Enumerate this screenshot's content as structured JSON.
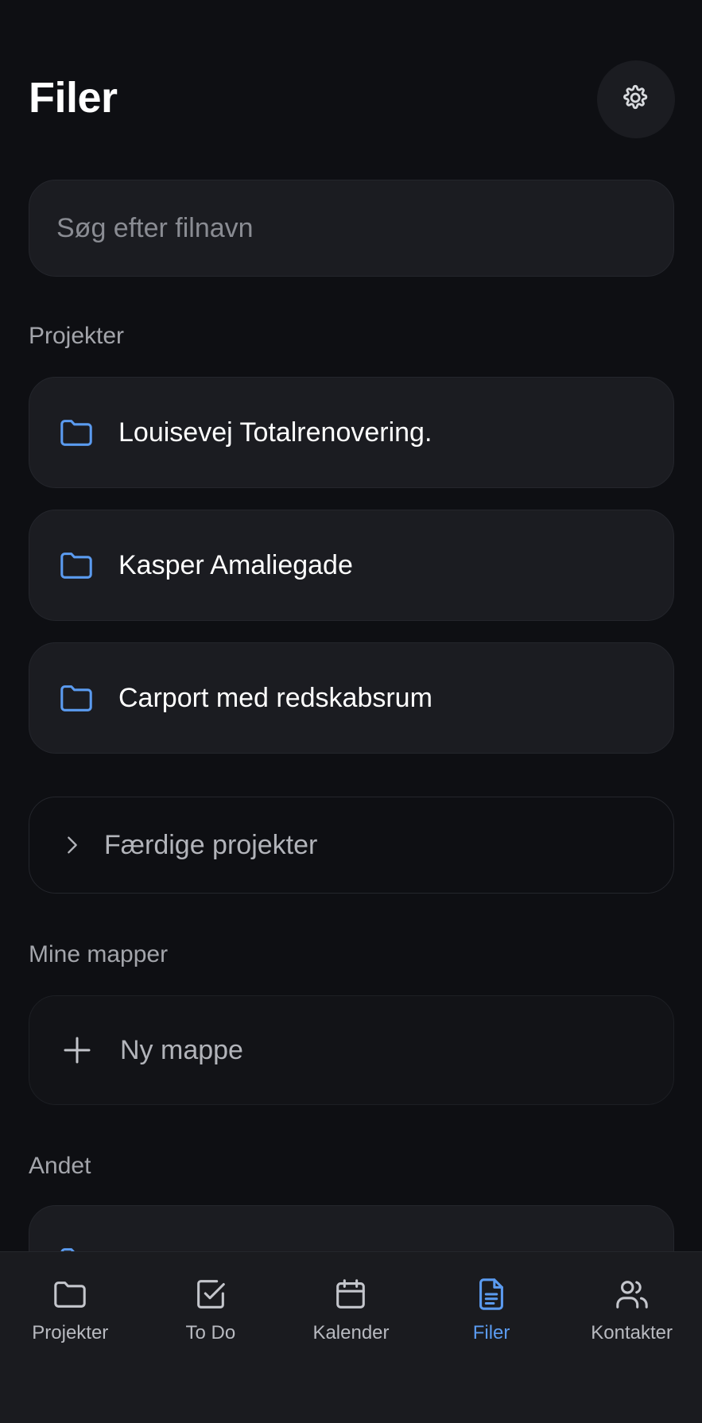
{
  "header": {
    "title": "Filer"
  },
  "search": {
    "placeholder": "Søg efter filnavn"
  },
  "sections": {
    "projects_label": "Projekter",
    "my_folders_label": "Mine mapper",
    "other_label": "Andet"
  },
  "projects": [
    {
      "label": "Louisevej Totalrenovering."
    },
    {
      "label": "Kasper Amaliegade"
    },
    {
      "label": "Carport med redskabsrum"
    }
  ],
  "completed_projects": {
    "label": "Færdige projekter"
  },
  "new_folder": {
    "label": "Ny mappe"
  },
  "tabbar": {
    "tabs": [
      {
        "label": "Projekter",
        "icon": "folder-icon"
      },
      {
        "label": "To Do",
        "icon": "checkbox-icon"
      },
      {
        "label": "Kalender",
        "icon": "calendar-icon"
      },
      {
        "label": "Filer",
        "icon": "document-icon",
        "active": true
      },
      {
        "label": "Kontakter",
        "icon": "users-icon"
      }
    ]
  },
  "colors": {
    "background": "#0e0f13",
    "card": "#1b1c21",
    "accent": "#5b9bf0",
    "muted_text": "#a3a5ab"
  }
}
